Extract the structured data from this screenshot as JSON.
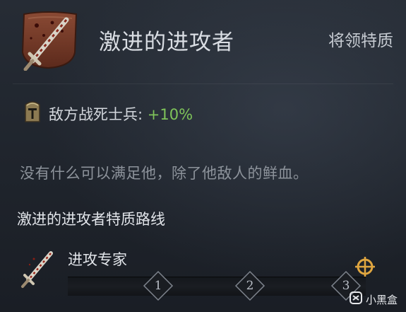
{
  "trait": {
    "title": "激进的进攻者",
    "type": "将领特质",
    "icon": "bloody-sword-shield-icon"
  },
  "effect": {
    "icon": "helmet-icon",
    "label": "敌方战死士兵: ",
    "value": "+10%",
    "value_color": "#7fc45a"
  },
  "flavor_text": "没有什么可以满足他，除了他敌人的鲜血。",
  "path": {
    "title_main": "激进的进攻者",
    "title_suffix": "特质路线",
    "level_name": "进攻专家",
    "level_icon": "bloody-sword-icon",
    "levels": [
      "1",
      "2",
      "3"
    ],
    "target_icon": "crosshair-icon"
  },
  "watermark": {
    "text": "小黑盒"
  }
}
